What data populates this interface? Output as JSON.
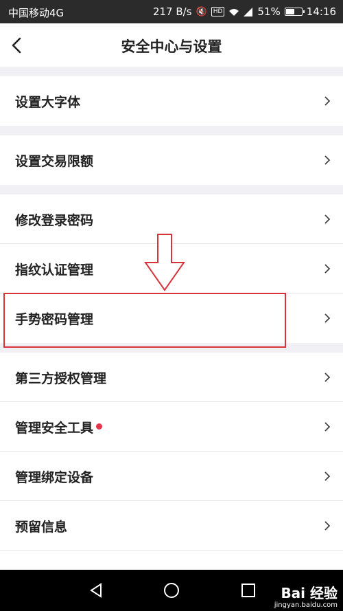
{
  "status_bar": {
    "carrier": "中国移动4G",
    "speed": "217 B/s",
    "battery": "51%",
    "time": "14:16",
    "icons": [
      "mute-icon",
      "hd-icon",
      "wifi-icon",
      "4g-icon",
      "signal-icon",
      "battery-icon"
    ]
  },
  "header": {
    "title": "安全中心与设置",
    "back_icon": "chevron-left-icon"
  },
  "menu": [
    {
      "label": "设置大字体"
    },
    {
      "label": "设置交易限额"
    },
    {
      "label": "修改登录密码"
    },
    {
      "label": "指纹认证管理"
    },
    {
      "label": "手势密码管理"
    },
    {
      "label": "第三方授权管理"
    },
    {
      "label": "管理安全工具"
    },
    {
      "label": "管理绑定设备"
    },
    {
      "label": "预留信息"
    }
  ],
  "colors": {
    "accent_red": "#d8333a",
    "badge_dot": "#e8354b",
    "section_gap": "#f0f0f5"
  },
  "watermark": {
    "brand": "Bai 经验",
    "url": "jingyan.baidu.com"
  }
}
